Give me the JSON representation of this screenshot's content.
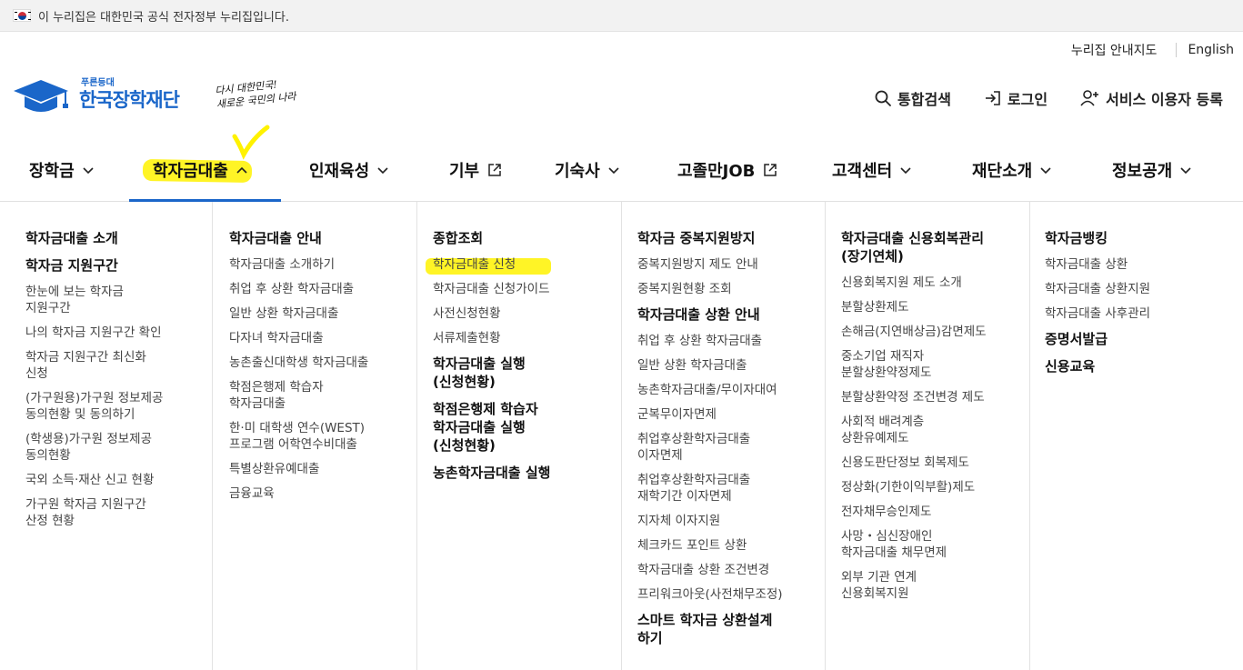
{
  "gov_banner": {
    "text": "이 누리집은 대한민국 공식 전자정부 누리집입니다."
  },
  "utility": {
    "sitemap": "누리집 안내지도",
    "english": "English"
  },
  "logo": {
    "tagline": "푸른등대",
    "name": "한국장학재단"
  },
  "slogan": {
    "line1": "다시 대한민국!",
    "line2": "새로운 국민의 나라"
  },
  "actions": {
    "search": "통합검색",
    "login": "로그인",
    "register": "서비스 이용자 등록"
  },
  "nav": [
    {
      "label": "장학금",
      "icon": "chevron-down-icon"
    },
    {
      "label": "학자금대출",
      "icon": "chevron-up-icon",
      "active": true
    },
    {
      "label": "인재육성",
      "icon": "chevron-down-icon"
    },
    {
      "label": "기부",
      "icon": "external-link-icon"
    },
    {
      "label": "기숙사",
      "icon": "chevron-down-icon"
    },
    {
      "label": "고졸만JOB",
      "icon": "external-link-icon"
    },
    {
      "label": "고객센터",
      "icon": "chevron-down-icon"
    },
    {
      "label": "재단소개",
      "icon": "chevron-down-icon"
    },
    {
      "label": "정보공개",
      "icon": "chevron-down-icon"
    }
  ],
  "menu": {
    "col1": {
      "h1": "학자금대출 소개",
      "h2": "학자금 지원구간",
      "items": [
        "한눈에 보는 학자금\n지원구간",
        "나의 학자금 지원구간 확인",
        "학자금 지원구간 최신화\n신청",
        "(가구원용)가구원 정보제공\n동의현황 및 동의하기",
        "(학생용)가구원 정보제공\n동의현황",
        "국외 소득·재산 신고 현황",
        "가구원 학자금 지원구간\n산정 현황"
      ]
    },
    "col2": {
      "h1": "학자금대출 안내",
      "items": [
        "학자금대출 소개하기",
        "취업 후 상환 학자금대출",
        "일반 상환 학자금대출",
        "다자녀 학자금대출",
        "농촌출신대학생 학자금대출",
        "학점은행제 학습자\n학자금대출",
        "한·미 대학생 연수(WEST)\n프로그램 어학연수비대출",
        "특별상환유예대출",
        "금융교육"
      ]
    },
    "col3": {
      "h1": "종합조회",
      "items": [
        "학자금대출 신청",
        "학자금대출 신청가이드",
        "사전신청현황",
        "서류제출현황"
      ],
      "h2": "학자금대출 실행\n(신청현황)",
      "h3": "학점은행제 학습자\n학자금대출 실행\n(신청현황)",
      "h4": "농촌학자금대출 실행"
    },
    "col4": {
      "h1": "학자금 중복지원방지",
      "items1": [
        "중복지원방지 제도 안내",
        "중복지원현황 조회"
      ],
      "h2": "학자금대출 상환 안내",
      "items2": [
        "취업 후 상환 학자금대출",
        "일반 상환 학자금대출",
        "농촌학자금대출/무이자대여",
        "군복무이자면제",
        "취업후상환학자금대출\n이자면제",
        "취업후상환학자금대출\n재학기간 이자면제",
        "지자체 이자지원",
        "체크카드 포인트 상환",
        "학자금대출 상환 조건변경",
        "프리워크아웃(사전채무조정)"
      ],
      "h3": "스마트 학자금 상환설계\n하기"
    },
    "col5": {
      "h1": "학자금대출 신용회복관리\n(장기연체)",
      "items": [
        "신용회복지원 제도 소개",
        "분할상환제도",
        "손해금(지연배상금)감면제도",
        "중소기업 재직자\n분할상환약정제도",
        "분할상환약정 조건변경 제도",
        "사회적 배려계층\n상환유예제도",
        "신용도판단정보 회복제도",
        "정상화(기한이익부활)제도",
        "전자채무승인제도",
        "사망・심신장애인\n학자금대출 채무면제",
        "외부 기관 연계\n신용회복지원"
      ]
    },
    "col6": {
      "h1": "학자금뱅킹",
      "items": [
        "학자금대출 상환",
        "학자금대출 상환지원",
        "학자금대출 사후관리"
      ],
      "h2": "증명서발급",
      "h3": "신용교육"
    }
  }
}
